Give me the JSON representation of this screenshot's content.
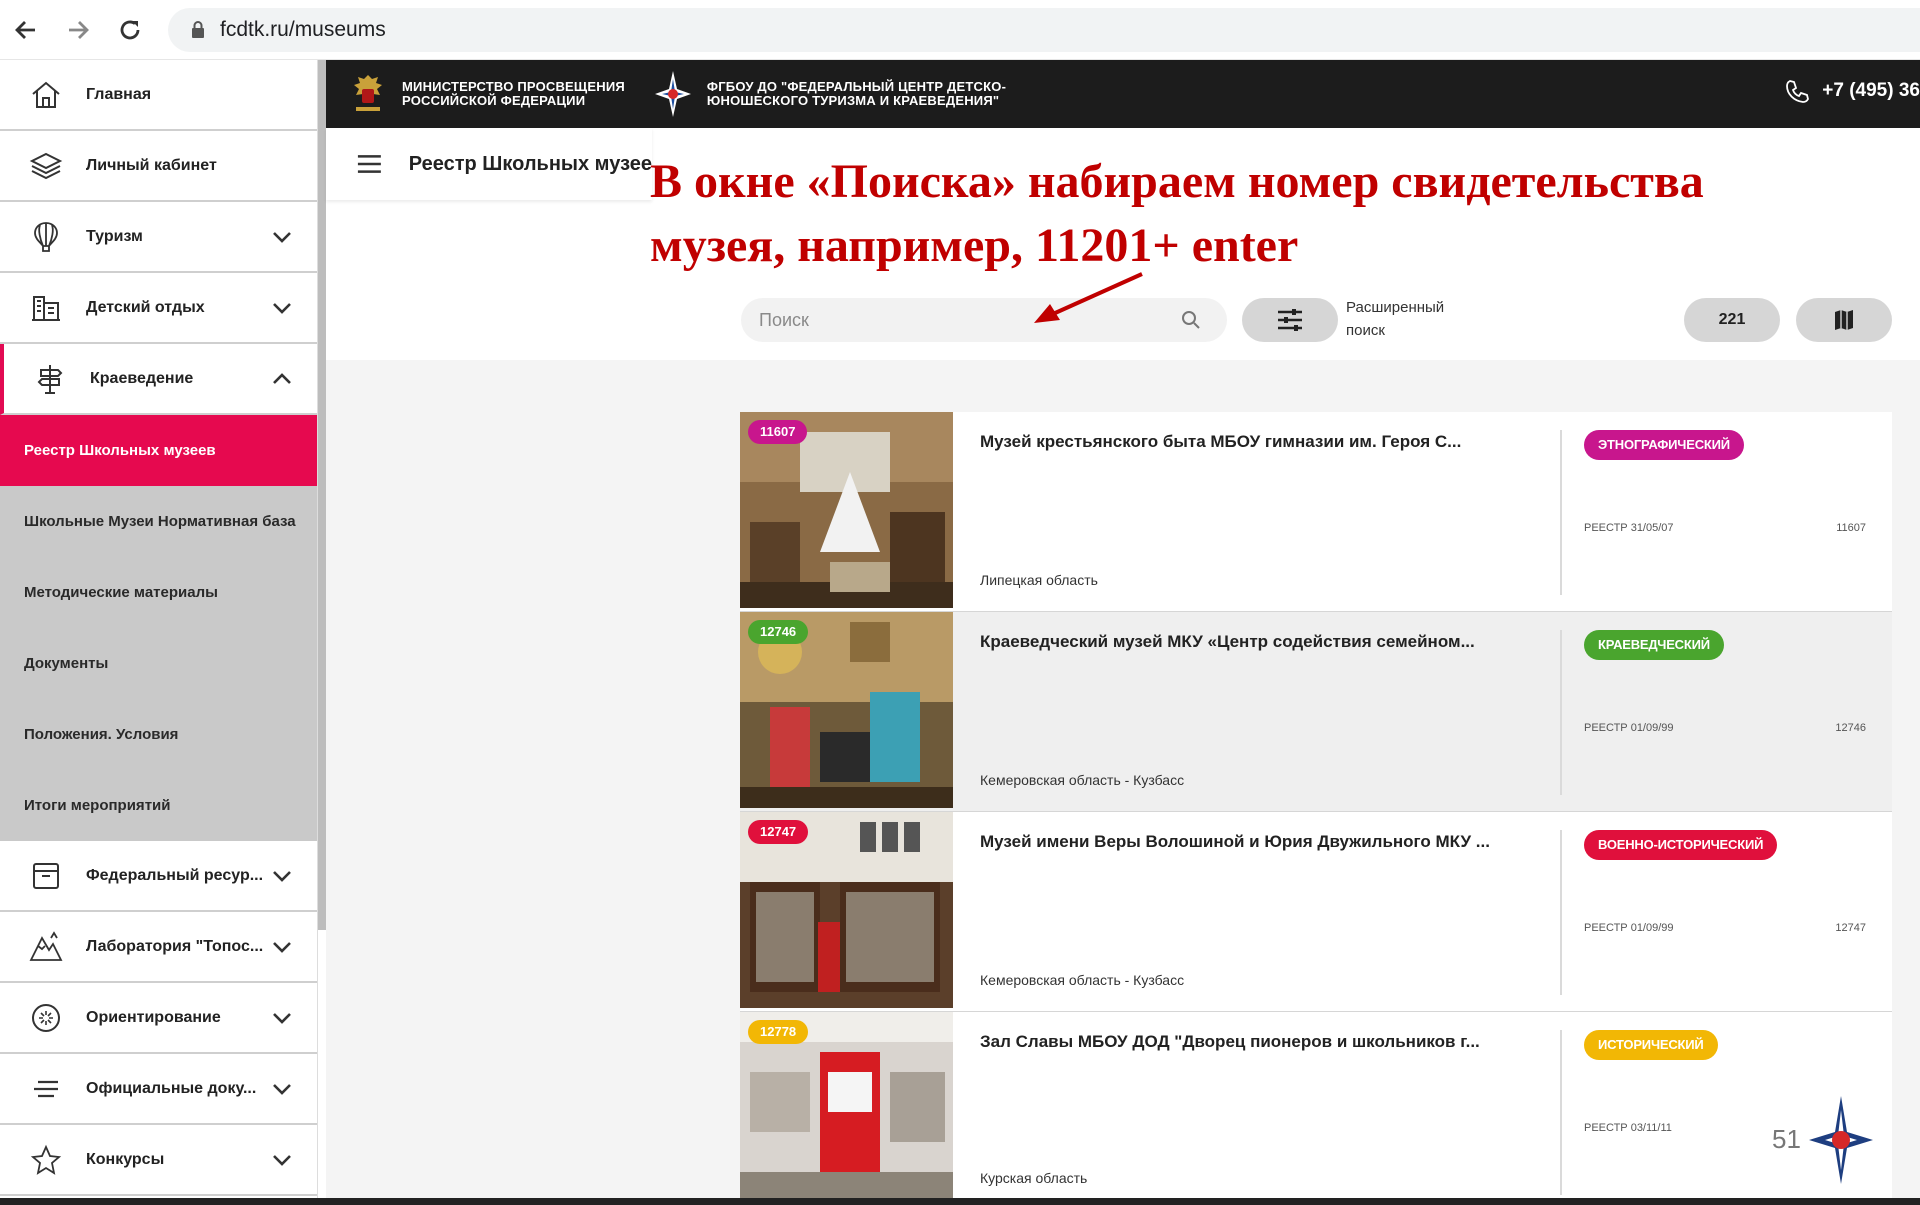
{
  "browser": {
    "url": "fcdtk.ru/museums"
  },
  "header": {
    "ministry_text_1": "МИНИСТЕРСТВО ПРОСВЕЩЕНИЯ",
    "ministry_text_2": "РОССИЙСКОЙ ФЕДЕРАЦИИ",
    "center_text_1": "ФГБОУ ДО \"ФЕДЕРАЛЬНЫЙ ЦЕНТР ДЕТСКО-",
    "center_text_2": "ЮНОШЕСКОГО ТУРИЗМА И КРАЕВЕДЕНИЯ\"",
    "phone": "+7 (495) 36"
  },
  "sidebar": {
    "items": [
      {
        "label": "Главная",
        "icon": "home-icon"
      },
      {
        "label": "Личный кабинет",
        "icon": "layers-icon"
      },
      {
        "label": "Туризм",
        "icon": "balloon-icon"
      },
      {
        "label": "Детский отдых",
        "icon": "building-icon"
      },
      {
        "label": "Краеведение",
        "icon": "signpost-icon"
      }
    ],
    "sub_items": [
      "Реестр Школьных музеев",
      "Школьные Музеи Нормативная база",
      "Методические материалы",
      "Документы",
      "Положения. Условия",
      "Итоги мероприятий"
    ],
    "items_after": [
      {
        "label": "Федеральный ресур...",
        "icon": "archive-icon"
      },
      {
        "label": "Лаборатория \"Топос...",
        "icon": "mountain-icon"
      },
      {
        "label": "Ориентирование",
        "icon": "compass-icon"
      },
      {
        "label": "Официальные доку...",
        "icon": "lines-icon"
      },
      {
        "label": "Конкурсы",
        "icon": "star-icon"
      }
    ]
  },
  "page": {
    "title": "Реестр Школьных музее"
  },
  "annotation": {
    "line1": "В окне «Поиска» набираем номер свидетельства",
    "line2": "музея, например, 11201+ enter"
  },
  "search": {
    "placeholder": "Поиск",
    "advanced_label_1": "Расширенный",
    "advanced_label_2": "поиск",
    "count": "221"
  },
  "museums": [
    {
      "num": "11607",
      "num_color": "#c8168d",
      "title": "Музей крестьянского быта МБОУ гимназии им. Героя С...",
      "region": "Липецкая область",
      "category": "ЭТНОГРАФИЧЕСКИЙ",
      "category_color": "#c8168d",
      "registry": "РЕЕСТР 31/05/07",
      "registry_num": "11607"
    },
    {
      "num": "12746",
      "num_color": "#4aa52e",
      "title": "Краеведческий музей МКУ «Центр содействия семейном...",
      "region": "Кемеровская область - Кузбасс",
      "category": "КРАЕВЕДЧЕСКИЙ",
      "category_color": "#4aa52e",
      "registry": "РЕЕСТР 01/09/99",
      "registry_num": "12746"
    },
    {
      "num": "12747",
      "num_color": "#e0103c",
      "title": "Музей имени Веры Волошиной и Юрия Двужильного МКУ ...",
      "region": "Кемеровская область - Кузбасс",
      "category": "ВОЕННО-ИСТОРИЧЕСКИЙ",
      "category_color": "#e0103c",
      "registry": "РЕЕСТР 01/09/99",
      "registry_num": "12747"
    },
    {
      "num": "12778",
      "num_color": "#f2b705",
      "title": "Зал Славы МБОУ ДОД \"Дворец пионеров и школьников г...",
      "region": "Курская область",
      "category": "ИСТОРИЧЕСКИЙ",
      "category_color": "#f2b705",
      "registry": "РЕЕСТР 03/11/11",
      "registry_num": ""
    }
  ],
  "slide_number": "51"
}
